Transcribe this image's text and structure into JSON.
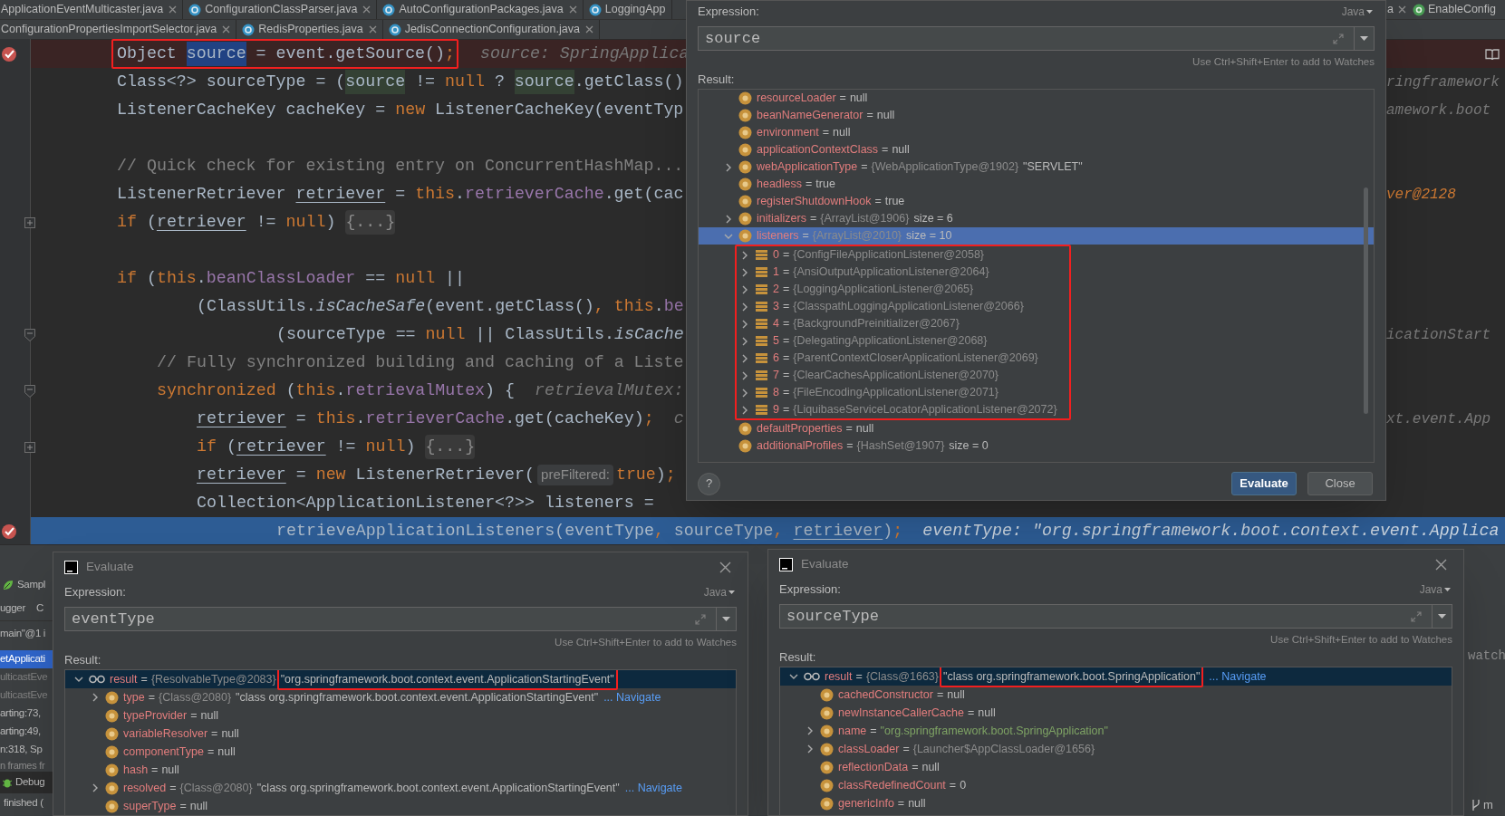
{
  "editor_tabs": {
    "rows": [
      [
        {
          "label": "ApplicationEventMulticaster.java",
          "closable": true
        },
        {
          "label": "ConfigurationClassParser.java",
          "kind": "class",
          "closable": true
        },
        {
          "label": "AutoConfigurationPackages.java",
          "kind": "class",
          "closable": true
        },
        {
          "label": "LoggingApp",
          "kind": "class",
          "closable": false
        }
      ],
      [
        {
          "label": "ConfigurationPropertiesImportSelector.java",
          "closable": true
        },
        {
          "label": "RedisProperties.java",
          "kind": "class",
          "closable": true
        },
        {
          "label": "JedisConnectionConfiguration.java",
          "kind": "class",
          "closable": true
        }
      ]
    ],
    "right_tabs": [
      {
        "label": "a",
        "closable": true
      },
      {
        "label": "EnableConfig",
        "kind": "annotation",
        "closable": false
      }
    ]
  },
  "editor": {
    "lines": [
      {
        "breakpoint": true,
        "segments": [
          {
            "kind": "plain",
            "text": "Object ",
            "framed": true
          },
          {
            "kind": "sel",
            "text": "source",
            "framed": true
          },
          {
            "kind": "plain",
            "text": " = event.getSource()",
            "framed": true
          },
          {
            "kind": "kw",
            "text": ";",
            "framed": true
          },
          {
            "kind": "hint",
            "text": "source: SpringApplica"
          }
        ]
      },
      {
        "segments": [
          {
            "kind": "plain",
            "text": "Class<?> sourceType = ("
          },
          {
            "kind": "usage",
            "text": "source"
          },
          {
            "kind": "plain",
            "text": " != "
          },
          {
            "kind": "kw",
            "text": "null"
          },
          {
            "kind": "plain",
            "text": " ? "
          },
          {
            "kind": "usage",
            "text": "source"
          },
          {
            "kind": "plain",
            "text": ".getClass()"
          }
        ],
        "tail": {
          "kind": "hint",
          "text": "ringframework"
        }
      },
      {
        "blank_after": true,
        "segments": [
          {
            "kind": "plain",
            "text": "ListenerCacheKey cacheKey = "
          },
          {
            "kind": "kw",
            "text": "new "
          },
          {
            "kind": "plain",
            "text": "ListenerCacheKey(eventTyp"
          }
        ],
        "tail": {
          "kind": "hint",
          "text": "amework.boot"
        }
      },
      {
        "segments": [
          {
            "kind": "comment",
            "text": "// Quick check for existing entry on ConcurrentHashMap..."
          }
        ]
      },
      {
        "segments": [
          {
            "kind": "plain",
            "text": "ListenerRetriever "
          },
          {
            "kind": "var",
            "text": "retriever"
          },
          {
            "kind": "plain",
            "text": " = "
          },
          {
            "kind": "kw",
            "text": "this"
          },
          {
            "kind": "plain",
            "text": "."
          },
          {
            "kind": "field",
            "text": "retrieverCache"
          },
          {
            "kind": "plain",
            "text": ".get(cac"
          }
        ],
        "tail": {
          "kind": "hintval",
          "text": "ver@2128"
        }
      },
      {
        "fold_expanded": false,
        "blank_after": true,
        "segments": [
          {
            "kind": "kw",
            "text": "if "
          },
          {
            "kind": "plain",
            "text": "("
          },
          {
            "kind": "var",
            "text": "retriever"
          },
          {
            "kind": "plain",
            "text": " != "
          },
          {
            "kind": "kw",
            "text": "null"
          },
          {
            "kind": "plain",
            "text": ") "
          },
          {
            "kind": "fold",
            "text": "{...}"
          }
        ]
      },
      {
        "segments": [
          {
            "kind": "kw",
            "text": "if "
          },
          {
            "kind": "plain",
            "text": "("
          },
          {
            "kind": "kw",
            "text": "this"
          },
          {
            "kind": "plain",
            "text": "."
          },
          {
            "kind": "field",
            "text": "beanClassLoader"
          },
          {
            "kind": "plain",
            "text": " == "
          },
          {
            "kind": "kw",
            "text": "null"
          },
          {
            "kind": "plain",
            "text": " ||"
          }
        ]
      },
      {
        "segments": [
          {
            "kind": "plain",
            "text": "        (ClassUtils."
          },
          {
            "kind": "static",
            "text": "isCacheSafe"
          },
          {
            "kind": "plain",
            "text": "(event.getClass()"
          },
          {
            "kind": "kw",
            "text": ", this"
          },
          {
            "kind": "plain",
            "text": "."
          },
          {
            "kind": "field",
            "text": "be"
          }
        ]
      },
      {
        "fold_expanded": true,
        "segments": [
          {
            "kind": "plain",
            "text": "                (sourceType == "
          },
          {
            "kind": "kw",
            "text": "null"
          },
          {
            "kind": "plain",
            "text": " || ClassUtils."
          },
          {
            "kind": "static",
            "text": "isCache"
          }
        ],
        "tail": {
          "kind": "hint",
          "text": "icationStart"
        }
      },
      {
        "segments": [
          {
            "kind": "comment",
            "text": "    // Fully synchronized building and caching of a Liste"
          }
        ]
      },
      {
        "fold_expanded": true,
        "segments": [
          {
            "kind": "kw",
            "text": "    synchronized "
          },
          {
            "kind": "plain",
            "text": "("
          },
          {
            "kind": "kw",
            "text": "this"
          },
          {
            "kind": "plain",
            "text": "."
          },
          {
            "kind": "field",
            "text": "retrievalMutex"
          },
          {
            "kind": "plain",
            "text": ") {"
          },
          {
            "kind": "hint",
            "text": "retrievalMutex:"
          }
        ]
      },
      {
        "segments": [
          {
            "kind": "var",
            "text": "        retriever"
          },
          {
            "kind": "plain",
            "text": " = "
          },
          {
            "kind": "kw",
            "text": "this"
          },
          {
            "kind": "plain",
            "text": "."
          },
          {
            "kind": "field",
            "text": "retrieverCache"
          },
          {
            "kind": "plain",
            "text": ".get(cacheKey)"
          },
          {
            "kind": "kw",
            "text": ";"
          },
          {
            "kind": "hint",
            "text": "c"
          }
        ],
        "tail": {
          "kind": "hint",
          "text": "xt.event.App"
        }
      },
      {
        "fold_expanded": false,
        "segments": [
          {
            "kind": "kw",
            "text": "        if "
          },
          {
            "kind": "plain",
            "text": "("
          },
          {
            "kind": "var",
            "text": "retriever"
          },
          {
            "kind": "plain",
            "text": " != "
          },
          {
            "kind": "kw",
            "text": "null"
          },
          {
            "kind": "plain",
            "text": ") "
          },
          {
            "kind": "fold",
            "text": "{...}"
          }
        ]
      },
      {
        "segments": [
          {
            "kind": "var",
            "text": "        retriever"
          },
          {
            "kind": "plain",
            "text": " = "
          },
          {
            "kind": "kw",
            "text": "new "
          },
          {
            "kind": "plain",
            "text": "ListenerRetriever("
          },
          {
            "kind": "param",
            "text": "preFiltered:"
          },
          {
            "kind": "kw",
            "text": "true"
          },
          {
            "kind": "plain",
            "text": ")"
          },
          {
            "kind": "kw",
            "text": ";"
          }
        ]
      },
      {
        "segments": [
          {
            "kind": "plain",
            "text": "        Collection<ApplicationListener<?>> listeners ="
          }
        ]
      },
      {
        "breakpoint": true,
        "execution_point": true,
        "segments": [
          {
            "kind": "plain",
            "text": "                retrieveApplicationListeners(eventType"
          },
          {
            "kind": "kw",
            "text": ", "
          },
          {
            "kind": "plain",
            "text": "sourceType"
          },
          {
            "kind": "kw",
            "text": ", "
          },
          {
            "kind": "var",
            "text": "retriever"
          },
          {
            "kind": "plain",
            "text": ")"
          },
          {
            "kind": "kw",
            "text": ";"
          },
          {
            "kind": "hint",
            "text": "eventType: \"org.springframework.boot.context.event.Applica"
          }
        ]
      }
    ]
  },
  "debug_panel": {
    "title": "Sampl",
    "tabs": [
      "ugger",
      "C"
    ],
    "thread": "main\"@1 i",
    "frames": [
      {
        "text": "etApplicati",
        "selected": true,
        "dimmed": false
      },
      {
        "text": "ulticastEve",
        "selected": false,
        "dimmed": true
      },
      {
        "text": "ulticastEve",
        "selected": false,
        "dimmed": true
      },
      {
        "text": "arting:73,",
        "selected": false,
        "dimmed": false
      },
      {
        "text": "arting:49,",
        "selected": false,
        "dimmed": false
      },
      {
        "text": "n:318, Sp",
        "selected": false,
        "dimmed": false
      }
    ],
    "frames_hint": "n frames fr",
    "tool_window": "Debug",
    "status": "finished ("
  },
  "right_strip": {
    "watch": "watch",
    "branch": "m"
  },
  "dialogs": [
    {
      "focused": true,
      "expression_label": "Expression:",
      "language": "Java",
      "expression": "source",
      "hint": "Use Ctrl+Shift+Enter to add to Watches",
      "result_label": "Result:",
      "help": "?",
      "tree": {
        "scrolled": true,
        "rows": [
          {
            "name": "resourceLoader",
            "kind": "field",
            "op": "=",
            "value": "null",
            "selected": false
          },
          {
            "name": "beanNameGenerator",
            "kind": "field",
            "op": "=",
            "value": "null",
            "selected": false
          },
          {
            "name": "environment",
            "kind": "field",
            "op": "=",
            "value": "null",
            "selected": false
          },
          {
            "name": "applicationContextClass",
            "kind": "field",
            "op": "=",
            "value": "null",
            "selected": false
          },
          {
            "name": "webApplicationType",
            "kind": "field",
            "op": "=",
            "ref": "{WebApplicationType@1902}",
            "value": "\"SERVLET\"",
            "expanded": false,
            "selected": false
          },
          {
            "name": "headless",
            "kind": "field",
            "op": "=",
            "value": "true",
            "selected": false
          },
          {
            "name": "registerShutdownHook",
            "kind": "field",
            "op": "=",
            "value": "true",
            "selected": false
          },
          {
            "name": "initializers",
            "kind": "field",
            "op": "=",
            "ref": "{ArrayList@1906}",
            "value": "size = 6",
            "expanded": false,
            "selected": false
          },
          {
            "name": "listeners",
            "kind": "field",
            "op": "=",
            "ref": "{ArrayList@2010}",
            "value": "size = 10",
            "expanded": true,
            "selected": true,
            "children": [
              {
                "name": "0",
                "kind": "element",
                "op": "=",
                "ref": "{ConfigFileApplicationListener@2058}",
                "expanded": false,
                "selected": false,
                "framed": true
              },
              {
                "name": "1",
                "kind": "element",
                "op": "=",
                "ref": "{AnsiOutputApplicationListener@2064}",
                "expanded": false,
                "selected": false,
                "framed": true
              },
              {
                "name": "2",
                "kind": "element",
                "op": "=",
                "ref": "{LoggingApplicationListener@2065}",
                "expanded": false,
                "selected": false,
                "framed": true
              },
              {
                "name": "3",
                "kind": "element",
                "op": "=",
                "ref": "{ClasspathLoggingApplicationListener@2066}",
                "expanded": false,
                "selected": false,
                "framed": true
              },
              {
                "name": "4",
                "kind": "element",
                "op": "=",
                "ref": "{BackgroundPreinitializer@2067}",
                "expanded": false,
                "selected": false,
                "framed": true
              },
              {
                "name": "5",
                "kind": "element",
                "op": "=",
                "ref": "{DelegatingApplicationListener@2068}",
                "expanded": false,
                "selected": false,
                "framed": true
              },
              {
                "name": "6",
                "kind": "element",
                "op": "=",
                "ref": "{ParentContextCloserApplicationListener@2069}",
                "expanded": false,
                "selected": false,
                "framed": true
              },
              {
                "name": "7",
                "kind": "element",
                "op": "=",
                "ref": "{ClearCachesApplicationListener@2070}",
                "expanded": false,
                "selected": false,
                "framed": true
              },
              {
                "name": "8",
                "kind": "element",
                "op": "=",
                "ref": "{FileEncodingApplicationListener@2071}",
                "expanded": false,
                "selected": false,
                "framed": true
              },
              {
                "name": "9",
                "kind": "element",
                "op": "=",
                "ref": "{LiquibaseServiceLocatorApplicationListener@2072}",
                "expanded": false,
                "selected": false,
                "framed": true
              }
            ]
          },
          {
            "name": "defaultProperties",
            "kind": "field",
            "op": "=",
            "value": "null",
            "selected": false
          },
          {
            "name": "additionalProfiles",
            "kind": "field",
            "op": "=",
            "ref": "{HashSet@1907}",
            "value": "size = 0",
            "selected": false
          }
        ]
      },
      "buttons": [
        {
          "label": "Evaluate",
          "kind": "primary"
        },
        {
          "label": "Close",
          "kind": "default"
        }
      ]
    },
    {
      "title": "Evaluate",
      "focused": false,
      "expression_label": "Expression:",
      "language": "Java",
      "expression": "eventType",
      "hint": "Use Ctrl+Shift+Enter to add to Watches",
      "result_label": "Result:",
      "tree": {
        "scrolled": false,
        "rows": [
          {
            "name": "result",
            "kind": "watch",
            "op": "=",
            "ref": "{ResolvableType@2083}",
            "value": "\"org.springframework.boot.context.event.ApplicationStartingEvent\"",
            "value_framed": true,
            "expanded": true,
            "selected": true,
            "children": [
              {
                "name": "type",
                "kind": "field",
                "op": "=",
                "ref": "{Class@2080}",
                "value": "\"class org.springframework.boot.context.event.ApplicationStartingEvent\"",
                "link": "... Navigate",
                "expanded": false,
                "selected": false
              },
              {
                "name": "typeProvider",
                "kind": "field",
                "op": "=",
                "value": "null",
                "selected": false
              },
              {
                "name": "variableResolver",
                "kind": "field",
                "op": "=",
                "value": "null",
                "selected": false
              },
              {
                "name": "componentType",
                "kind": "field",
                "op": "=",
                "value": "null",
                "selected": false
              },
              {
                "name": "hash",
                "kind": "field",
                "op": "=",
                "value": "null",
                "selected": false
              },
              {
                "name": "resolved",
                "kind": "field",
                "op": "=",
                "ref": "{Class@2080}",
                "value": "\"class org.springframework.boot.context.event.ApplicationStartingEvent\"",
                "link": "... Navigate",
                "expanded": false,
                "selected": false
              },
              {
                "name": "superType",
                "kind": "field",
                "op": "=",
                "value": "null",
                "selected": false
              }
            ]
          }
        ]
      }
    },
    {
      "title": "Evaluate",
      "focused": false,
      "expression_label": "Expression:",
      "language": "Java",
      "expression": "sourceType",
      "hint": "Use Ctrl+Shift+Enter to add to Watches",
      "result_label": "Result:",
      "tree": {
        "scrolled": false,
        "rows": [
          {
            "name": "result",
            "kind": "watch",
            "op": "=",
            "ref": "{Class@1663}",
            "value": "\"class org.springframework.boot.SpringApplication\"",
            "value_framed": true,
            "link": "... Navigate",
            "expanded": true,
            "selected": true,
            "children": [
              {
                "name": "cachedConstructor",
                "kind": "field",
                "op": "=",
                "value": "null",
                "selected": false
              },
              {
                "name": "newInstanceCallerCache",
                "kind": "field",
                "op": "=",
                "value": "null",
                "selected": false
              },
              {
                "name": "name",
                "kind": "field",
                "op": "=",
                "value": "\"org.springframework.boot.SpringApplication\"",
                "string": true,
                "expanded": false,
                "selected": false
              },
              {
                "name": "classLoader",
                "kind": "field",
                "op": "=",
                "ref": "{Launcher$AppClassLoader@1656}",
                "expanded": false,
                "selected": false
              },
              {
                "name": "reflectionData",
                "kind": "field",
                "op": "=",
                "value": "null",
                "selected": false
              },
              {
                "name": "classRedefinedCount",
                "kind": "field",
                "op": "=",
                "value": "0",
                "selected": false
              },
              {
                "name": "genericInfo",
                "kind": "field",
                "op": "=",
                "value": "null",
                "selected": false
              }
            ]
          }
        ]
      }
    }
  ]
}
